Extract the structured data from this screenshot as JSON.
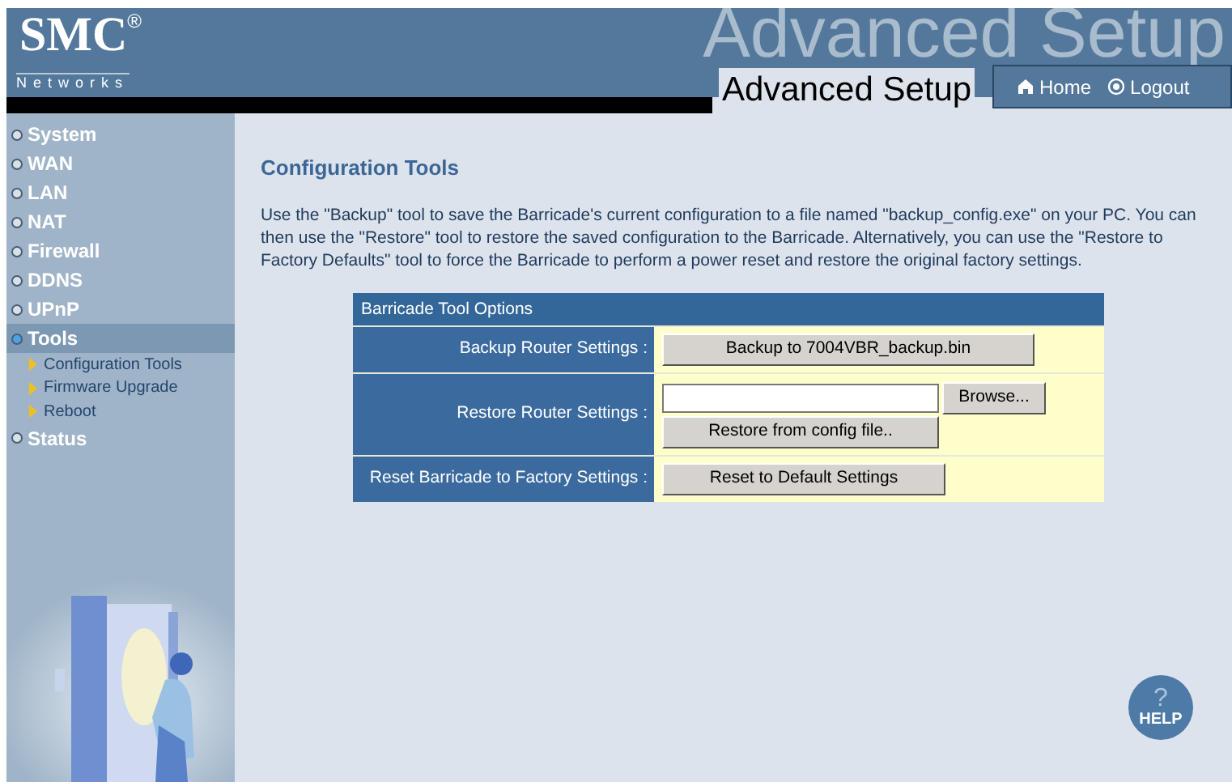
{
  "header": {
    "logo": "SMC",
    "logo_mark": "®",
    "logo_sub": "Networks",
    "banner_text": "Advanced Setup",
    "page_title": "Advanced Setup",
    "nav": [
      {
        "label": "Home",
        "kind": "home"
      },
      {
        "label": "Logout",
        "kind": "logout"
      }
    ]
  },
  "sidebar": {
    "items": [
      {
        "label": "System",
        "selected": false
      },
      {
        "label": "WAN",
        "selected": false
      },
      {
        "label": "LAN",
        "selected": false
      },
      {
        "label": "NAT",
        "selected": false
      },
      {
        "label": "Firewall",
        "selected": false
      },
      {
        "label": "DDNS",
        "selected": false
      },
      {
        "label": "UPnP",
        "selected": false
      },
      {
        "label": "Tools",
        "selected": true,
        "children": [
          {
            "label": "Configuration Tools"
          },
          {
            "label": "Firmware Upgrade"
          },
          {
            "label": "Reboot"
          }
        ]
      },
      {
        "label": "Status",
        "selected": false
      }
    ]
  },
  "content": {
    "title": "Configuration Tools",
    "description": "Use the \"Backup\" tool to save the Barricade's current configuration to a file named \"backup_config.exe\" on your PC. You can then use the \"Restore\" tool to restore the saved configuration to the Barricade. Alternatively, you can use the \"Restore to Factory Defaults\" tool to force the Barricade to perform a power reset and restore the original factory settings.",
    "table": {
      "title": "Barricade Tool Options",
      "rows": [
        {
          "label": "Backup Router Settings :",
          "kind": "button",
          "button": "Backup to 7004VBR_backup.bin"
        },
        {
          "label": "Restore Router Settings :",
          "kind": "file",
          "browse": "Browse...",
          "button": "Restore from config file.."
        },
        {
          "label": "Reset Barricade to Factory Settings :",
          "kind": "button",
          "button": "Reset to Default Settings"
        }
      ]
    },
    "help": "HELP",
    "help_mark": "?"
  }
}
